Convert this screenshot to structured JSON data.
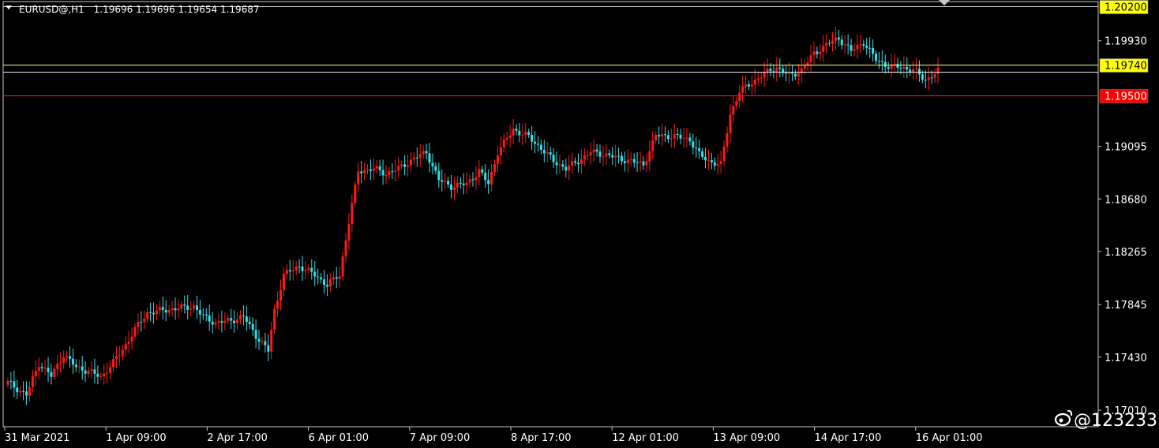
{
  "header": {
    "symbol": "EURUSD@,H1",
    "ohlc": "1.19696 1.19696 1.19654 1.19687"
  },
  "watermark": {
    "text": "@123233",
    "icon": "weibo-logo-icon"
  },
  "colors": {
    "background": "#000000",
    "bull": "#ff1a1a",
    "bear": "#33e0e8",
    "frame": "#c8c8c8",
    "hline_white": "#e8e8e8",
    "hline_yellow": "#ffff80",
    "hline_red": "#ff2020",
    "label_yellow": "#ffff00",
    "label_red": "#ff0000"
  },
  "price_axis": {
    "ticks": [
      "1.19930",
      "1.19095",
      "1.18680",
      "1.18265",
      "1.17845",
      "1.17430",
      "1.17010"
    ]
  },
  "time_axis": {
    "labels": [
      "31 Mar 2021",
      "1 Apr 09:00",
      "2 Apr 17:00",
      "6 Apr 01:00",
      "7 Apr 09:00",
      "8 Apr 17:00",
      "12 Apr 01:00",
      "13 Apr 09:00",
      "14 Apr 17:00",
      "16 Apr 01:00"
    ]
  },
  "horizontal_levels": [
    {
      "price": "1.20200",
      "line": "white",
      "label": "yellow"
    },
    {
      "price": "1.19740",
      "line": "yellow",
      "label": "yellow"
    },
    {
      "price": "1.19687",
      "line": "white",
      "label": "none"
    },
    {
      "price": "1.19500",
      "line": "red",
      "label": "red"
    }
  ],
  "chart_data": {
    "type": "candlestick",
    "symbol": "EURUSD@",
    "timeframe": "H1",
    "ylim": [
      1.1688,
      1.2024
    ],
    "x_labels": [
      "31 Mar 2021",
      "1 Apr 09:00",
      "2 Apr 17:00",
      "6 Apr 01:00",
      "7 Apr 09:00",
      "8 Apr 17:00",
      "12 Apr 01:00",
      "13 Apr 09:00",
      "14 Apr 17:00",
      "16 Apr 01:00"
    ],
    "y_ticks": [
      1.1993,
      1.19095,
      1.1868,
      1.18265,
      1.17845,
      1.1743,
      1.1701
    ],
    "last": {
      "open": 1.19696,
      "high": 1.19696,
      "low": 1.19654,
      "close": 1.19687
    },
    "close_path_anchors": [
      [
        0,
        1.1723
      ],
      [
        6,
        1.1713
      ],
      [
        10,
        1.1738
      ],
      [
        14,
        1.1728
      ],
      [
        18,
        1.1745
      ],
      [
        22,
        1.1735
      ],
      [
        26,
        1.1732
      ],
      [
        30,
        1.1727
      ],
      [
        36,
        1.1745
      ],
      [
        41,
        1.1765
      ],
      [
        45,
        1.1778
      ],
      [
        50,
        1.178
      ],
      [
        56,
        1.1782
      ],
      [
        60,
        1.1783
      ],
      [
        63,
        1.1775
      ],
      [
        67,
        1.177
      ],
      [
        72,
        1.1772
      ],
      [
        76,
        1.1775
      ],
      [
        80,
        1.176
      ],
      [
        84,
        1.1748
      ],
      [
        86,
        1.178
      ],
      [
        89,
        1.1808
      ],
      [
        94,
        1.1815
      ],
      [
        99,
        1.1808
      ],
      [
        103,
        1.18
      ],
      [
        107,
        1.1808
      ],
      [
        110,
        1.185
      ],
      [
        113,
        1.189
      ],
      [
        118,
        1.1892
      ],
      [
        122,
        1.1888
      ],
      [
        126,
        1.1892
      ],
      [
        131,
        1.19
      ],
      [
        135,
        1.1905
      ],
      [
        139,
        1.1883
      ],
      [
        143,
        1.1878
      ],
      [
        148,
        1.188
      ],
      [
        152,
        1.189
      ],
      [
        155,
        1.188
      ],
      [
        158,
        1.1905
      ],
      [
        163,
        1.1923
      ],
      [
        168,
        1.1917
      ],
      [
        172,
        1.1908
      ],
      [
        176,
        1.1898
      ],
      [
        180,
        1.1892
      ],
      [
        184,
        1.1898
      ],
      [
        188,
        1.1905
      ],
      [
        193,
        1.1903
      ],
      [
        197,
        1.19
      ],
      [
        201,
        1.1898
      ],
      [
        205,
        1.1895
      ],
      [
        209,
        1.1918
      ],
      [
        213,
        1.1918
      ],
      [
        216,
        1.1917
      ],
      [
        220,
        1.1915
      ],
      [
        223,
        1.1903
      ],
      [
        226,
        1.1898
      ],
      [
        230,
        1.1895
      ],
      [
        233,
        1.1935
      ],
      [
        236,
        1.1953
      ],
      [
        240,
        1.196
      ],
      [
        244,
        1.1967
      ],
      [
        248,
        1.1972
      ],
      [
        252,
        1.1965
      ],
      [
        256,
        1.197
      ],
      [
        260,
        1.1983
      ],
      [
        264,
        1.199
      ],
      [
        268,
        1.1995
      ],
      [
        272,
        1.1985
      ],
      [
        276,
        1.1992
      ],
      [
        280,
        1.1978
      ],
      [
        284,
        1.1973
      ],
      [
        288,
        1.1972
      ],
      [
        292,
        1.197
      ],
      [
        296,
        1.1962
      ],
      [
        300,
        1.1969
      ]
    ]
  }
}
